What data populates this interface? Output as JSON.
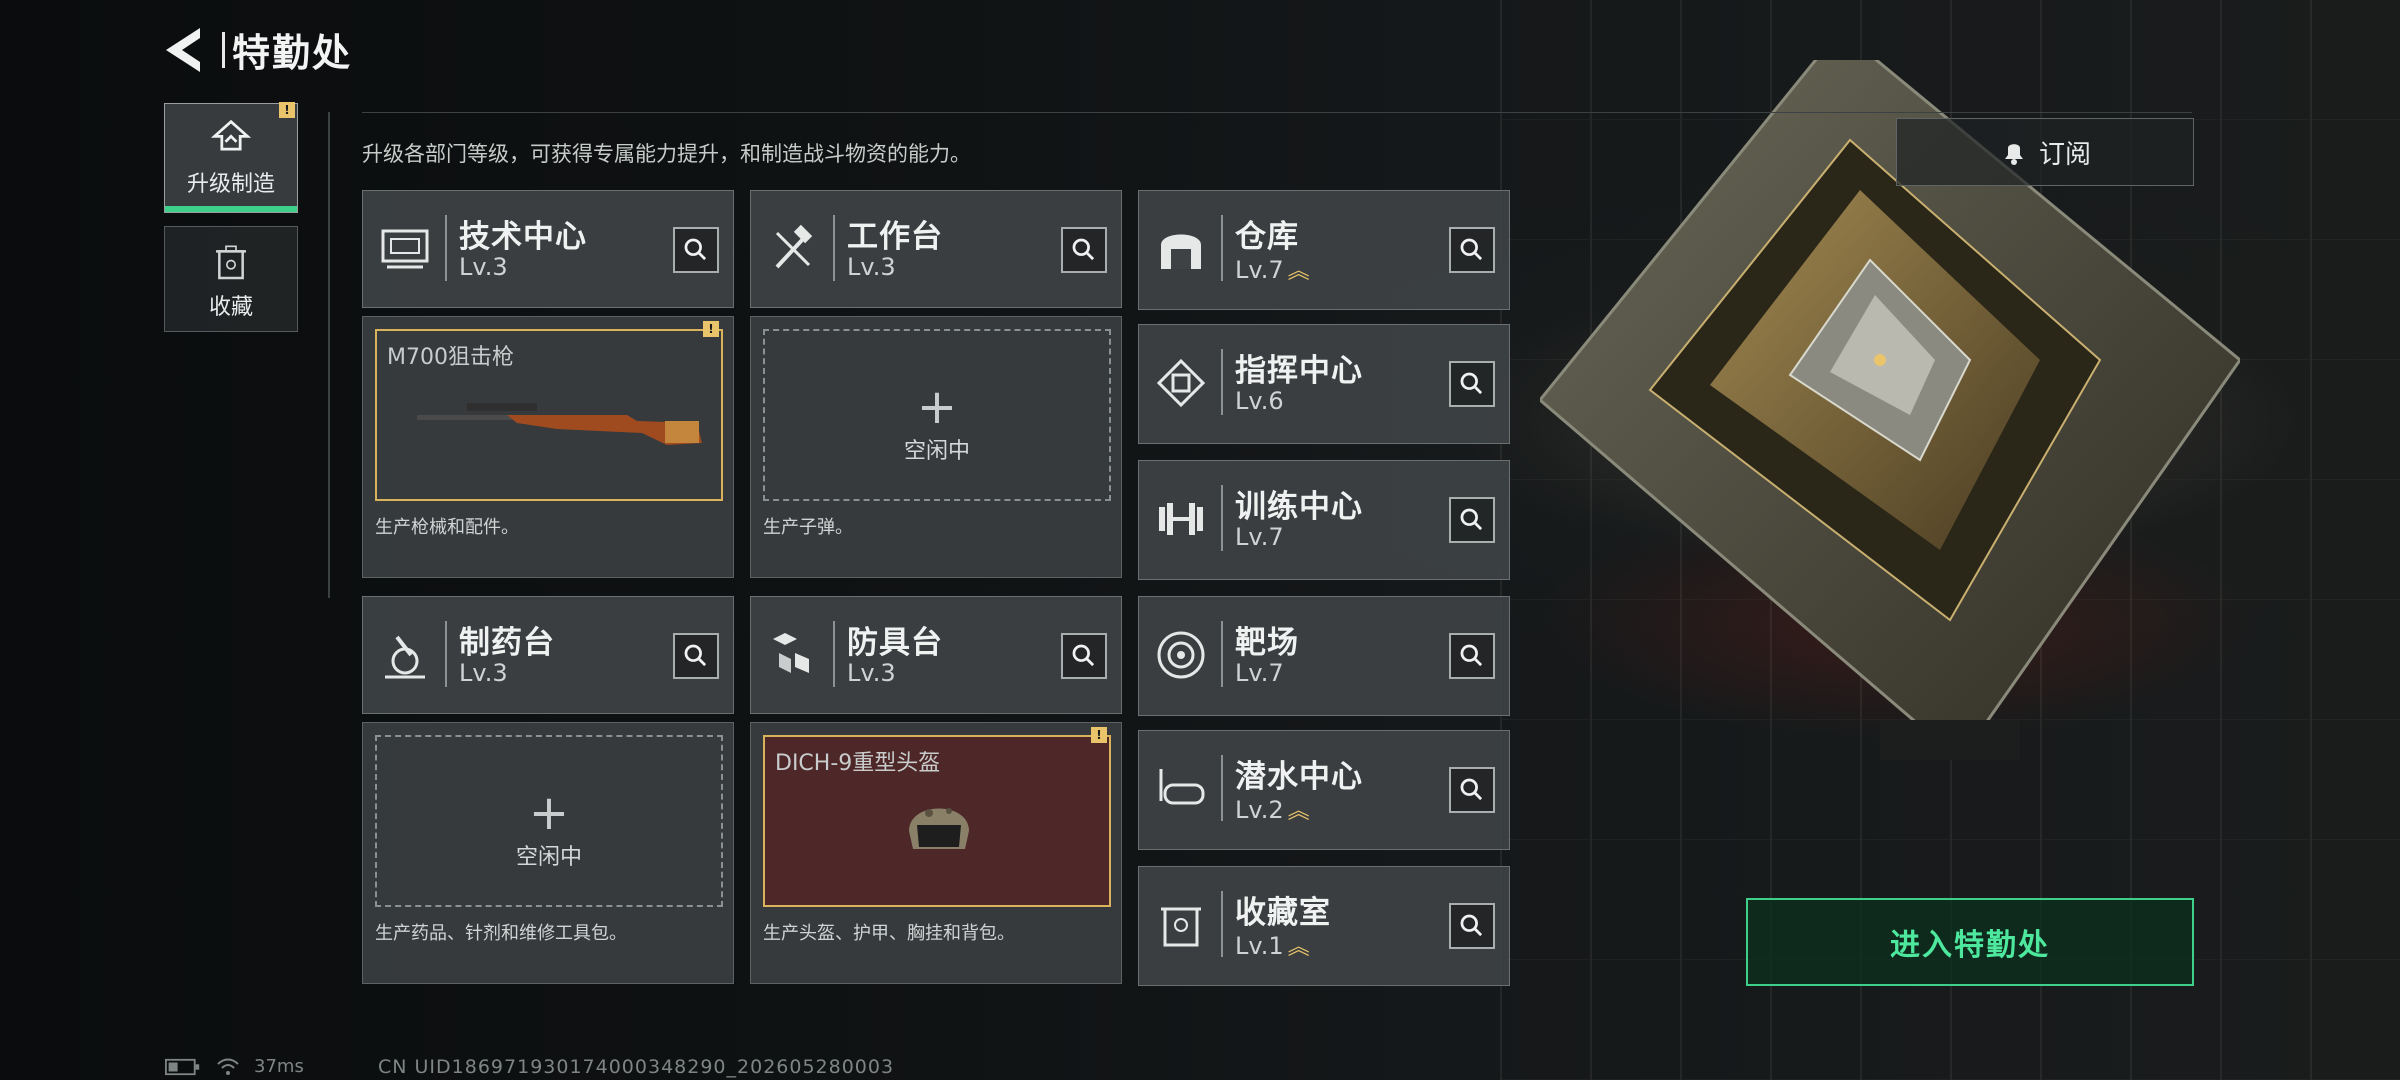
{
  "header": {
    "title": "特勤处"
  },
  "tabs": [
    {
      "label": "升级制造",
      "badge": "!"
    },
    {
      "label": "收藏"
    }
  ],
  "description": "升级各部门等级，可获得专属能力提升，和制造战斗物资的能力。",
  "subscribe_label": "订阅",
  "enter_label": "进入特勤处",
  "departments": [
    {
      "name": "技术中心",
      "level": "Lv.3"
    },
    {
      "name": "工作台",
      "level": "Lv.3"
    },
    {
      "name": "制药台",
      "level": "Lv.3"
    },
    {
      "name": "防具台",
      "level": "Lv.3"
    },
    {
      "name": "仓库",
      "level": "Lv.7"
    },
    {
      "name": "指挥中心",
      "level": "Lv.6"
    },
    {
      "name": "训练中心",
      "level": "Lv.7"
    },
    {
      "name": "靶场",
      "level": "Lv.7"
    },
    {
      "name": "潜水中心",
      "level": "Lv.2"
    },
    {
      "name": "收藏室",
      "level": "Lv.1"
    }
  ],
  "production": [
    {
      "item": "M700狙击枪",
      "desc": "生产枪械和配件。",
      "badge": "!"
    },
    {
      "state": "空闲中",
      "desc": "生产子弹。"
    },
    {
      "state": "空闲中",
      "desc": "生产药品、针剂和维修工具包。"
    },
    {
      "item": "DICH-9重型头盔",
      "desc": "生产头盔、护甲、胸挂和背包。",
      "badge": "!"
    }
  ],
  "status": {
    "ping": "37ms",
    "uid": "CN UID186971930174000348290_202605280003"
  },
  "colors": {
    "accent": "#3ed08a",
    "notice": "#e9c46a",
    "helmet_bg": "#4e2828"
  }
}
